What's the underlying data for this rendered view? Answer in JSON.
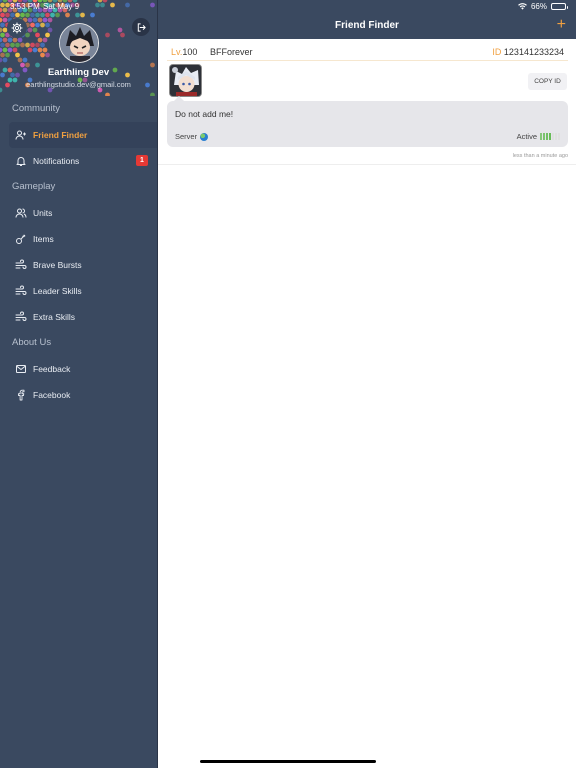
{
  "status_bar": {
    "time": "3:53 PM",
    "date": "Sat May 9",
    "battery_percent_label": "66%",
    "battery_level": 0.66
  },
  "sidebar": {
    "user": {
      "name": "Earthling Dev",
      "email": "earthlingstudio.dev@gmail.com"
    },
    "sections": [
      {
        "title": "Community",
        "items": [
          {
            "label": "Friend Finder",
            "icon": "add-friend-icon",
            "active": true
          },
          {
            "label": "Notifications",
            "icon": "bell-icon",
            "badge": "1"
          }
        ]
      },
      {
        "title": "Gameplay",
        "items": [
          {
            "label": "Units",
            "icon": "users-icon"
          },
          {
            "label": "Items",
            "icon": "key-icon"
          },
          {
            "label": "Brave Bursts",
            "icon": "wind-icon"
          },
          {
            "label": "Leader Skills",
            "icon": "wind-icon"
          },
          {
            "label": "Extra Skills",
            "icon": "wind-icon"
          }
        ]
      },
      {
        "title": "About Us",
        "items": [
          {
            "label": "Feedback",
            "icon": "mail-icon"
          },
          {
            "label": "Facebook",
            "icon": "facebook-icon"
          }
        ]
      }
    ]
  },
  "header": {
    "title": "Friend Finder",
    "add_label": "+"
  },
  "friend_card": {
    "level_label": "Lv.",
    "level": "100",
    "name": "BFForever",
    "id_label": "ID",
    "id": "123141233234",
    "copy_label": "COPY ID",
    "message": "Do not add me!",
    "server_label": "Server",
    "activity_label": "Active",
    "activity_level": 4,
    "activity_max": 7,
    "timestamp": "less than a minute ago"
  },
  "colors": {
    "accent": "#f0a040",
    "sidebar_bg": "#3a4960",
    "badge": "#e53935",
    "active_green": "#5cb94a"
  }
}
